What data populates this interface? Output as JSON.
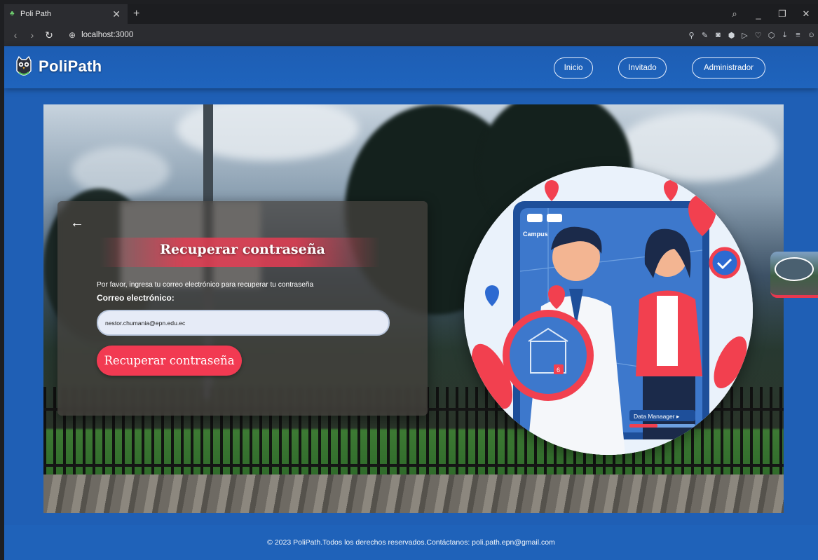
{
  "browser": {
    "tab_title": "Poli Path",
    "tab_close_icon": "close-icon",
    "new_tab_label": "+",
    "url": "localhost:3000",
    "window_controls": [
      "search",
      "minimize",
      "restore",
      "close"
    ]
  },
  "header": {
    "brand": "PoliPath",
    "nav": {
      "inicio": "Inicio",
      "invitado": "Invitado",
      "administrador": "Administrador"
    }
  },
  "form": {
    "title": "Recuperar contraseña",
    "helper_text": "Por favor, ingresa tu correo electrónico para recuperar tu contraseña",
    "email_label": "Correo electrónico:",
    "email_value": "nestor.chumania@epn.edu.ec",
    "submit_label": "Recuperar contraseña"
  },
  "illustration": {
    "campus_label": "Campus",
    "data_manager_label": "Data Manaager ▸",
    "badge": "6"
  },
  "footer": {
    "text": "© 2023 PoliPath.Todos los derechos reservados.Contáctanos: poli.path.epn@gmail.com"
  },
  "colors": {
    "brand_blue": "#1f62b9",
    "accent_red": "#f23a52",
    "input_bg": "#e6ebf7"
  }
}
